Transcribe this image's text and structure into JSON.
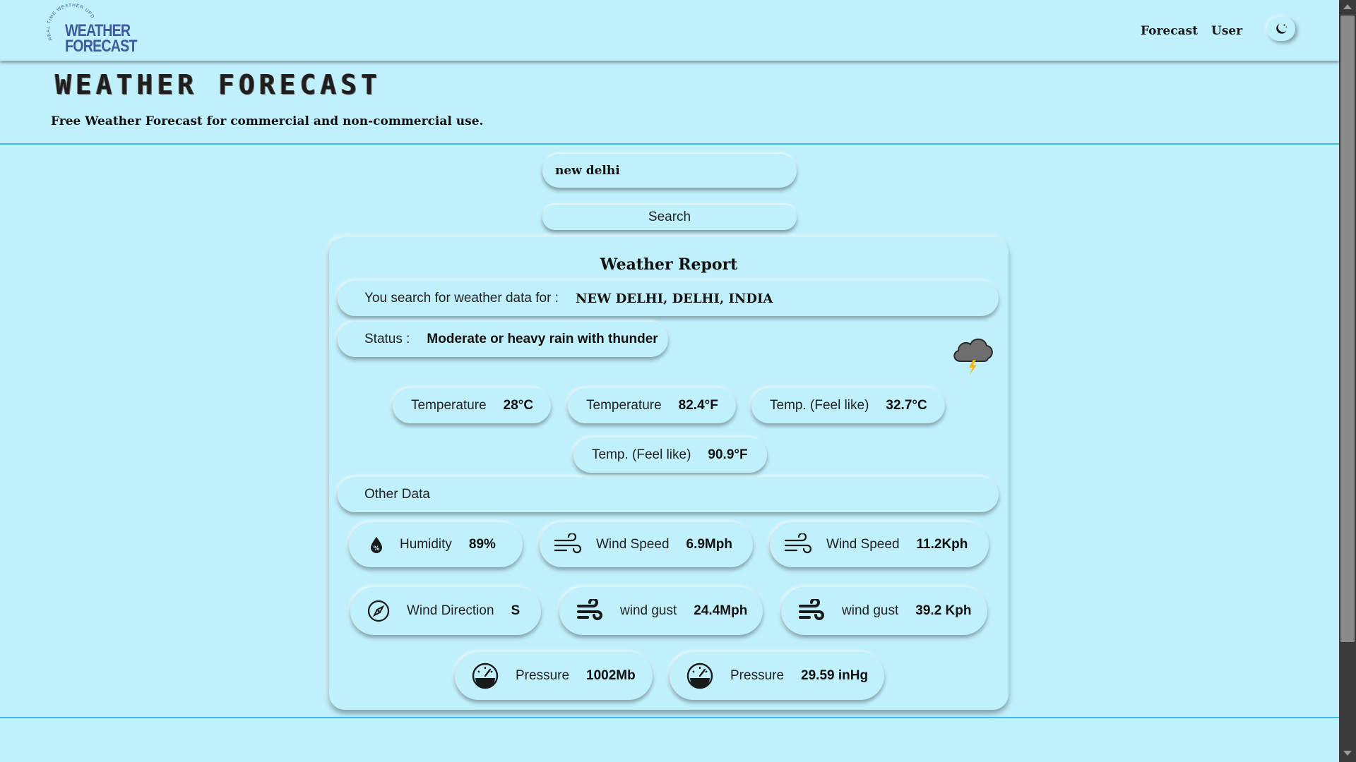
{
  "nav": {
    "logo_arc_text": "REAL TIME WEATHER UPDATE",
    "logo_line1": "WEATHER",
    "logo_line2": "FORECAST",
    "forecast_link": "Forecast",
    "user_link": "User",
    "theme_icon": "moon-icon"
  },
  "header": {
    "title": "WEATHER FORECAST",
    "subtitle": "Free Weather Forecast for commercial and non-commercial use."
  },
  "search": {
    "value": "new delhi",
    "button_label": "Search"
  },
  "report": {
    "title": "Weather Report",
    "location_label": "You search for weather data for :",
    "location_value": "NEW DELHI, DELHI, INDIA",
    "status_label": "Status :",
    "status_value": "Moderate or heavy rain with thunder",
    "status_icon": "thunderstorm-cloud-icon",
    "temps": [
      {
        "label": "Temperature",
        "value": "28°C"
      },
      {
        "label": "Temperature",
        "value": "82.4°F"
      },
      {
        "label": "Temp. (Feel like)",
        "value": "32.7°C"
      },
      {
        "label": "Temp. (Feel like)",
        "value": "90.9°F"
      }
    ],
    "other_label": "Other Data",
    "other": [
      {
        "icon": "humidity-drop-icon",
        "label": "Humidity",
        "value": "89%"
      },
      {
        "icon": "wind-icon",
        "label": "Wind Speed",
        "value": "6.9Mph"
      },
      {
        "icon": "wind-icon",
        "label": "Wind Speed",
        "value": "11.2Kph"
      },
      {
        "icon": "compass-icon",
        "label": "Wind Direction",
        "value": "S"
      },
      {
        "icon": "wind-gust-icon",
        "label": "wind gust",
        "value": "24.4Mph"
      },
      {
        "icon": "wind-gust-icon",
        "label": "wind gust",
        "value": "39.2 Kph"
      },
      {
        "icon": "gauge-icon",
        "label": "Pressure",
        "value": "1002Mb"
      },
      {
        "icon": "gauge-icon",
        "label": "Pressure",
        "value": "29.59 inHg"
      }
    ]
  },
  "colors": {
    "background": "#c0f0fc",
    "divider": "#3cc0e0",
    "logo": "#3f5b9c",
    "lightning": "#f2b80c"
  }
}
